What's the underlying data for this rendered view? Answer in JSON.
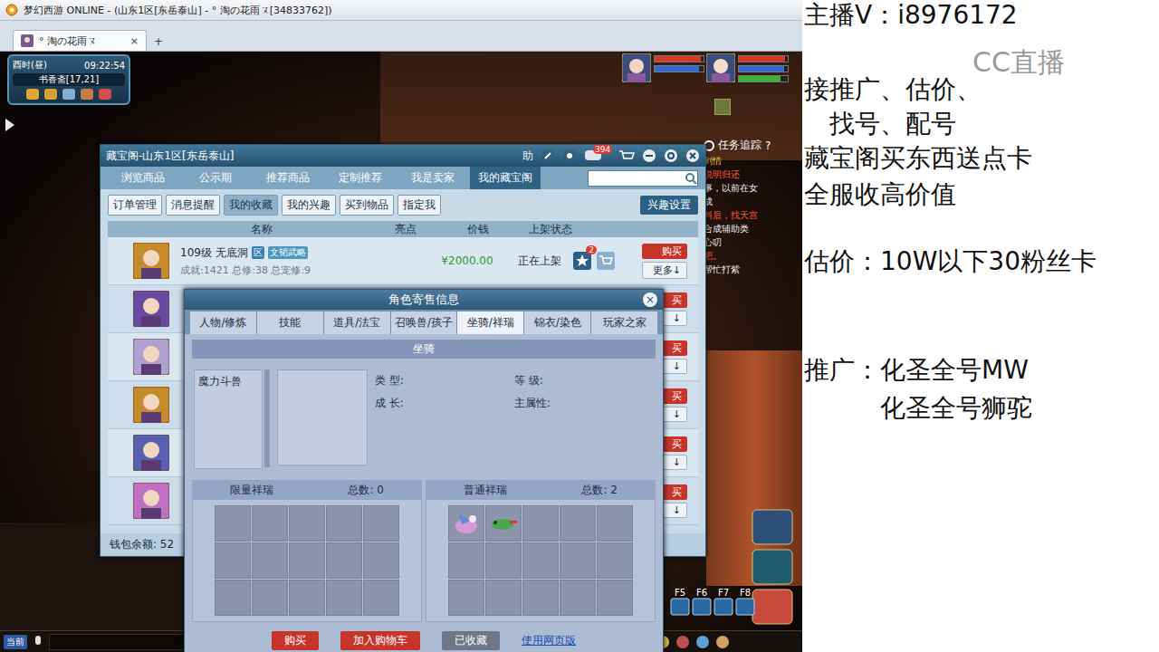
{
  "window": {
    "title": "梦幻西游 ONLINE - (山东1区[东岳泰山] - ° 淘の花雨ㄡ[34833762])",
    "tab": "° 淘の花雨ㄡ",
    "tab_close": "×",
    "new_tab": "+"
  },
  "hud": {
    "time": "酉时(昼)",
    "clock": "09:22:54",
    "location": "书香斋[17,21]",
    "task_title": "任务追踪",
    "task_help": "?",
    "task_lines": [
      "剑情",
      "说明归还",
      "事，以前在女",
      "成",
      "料后，找天宫",
      "合成辅助类",
      "心叨",
      "吧。",
      "帮忙打紫"
    ],
    "hotkeys": [
      "F5",
      "F6",
      "F7",
      "F8"
    ],
    "channel": "当前",
    "pet_bars": [
      {
        "color": "#d63a2a",
        "level": 0.95
      },
      {
        "color": "#2f6bd6",
        "level": 0.9
      }
    ],
    "player_bars": [
      {
        "color": "#d63a2a",
        "level": 0.95
      },
      {
        "color": "#2f6bd6",
        "level": 0.92
      },
      {
        "color": "#38b43a",
        "level": 0.85
      }
    ]
  },
  "cbg": {
    "title": "藏宝阁-山东1区[东岳泰山]",
    "help": "助",
    "message_count": "394",
    "tabs": [
      {
        "label": "浏览商品",
        "selected": false
      },
      {
        "label": "公示期",
        "selected": false
      },
      {
        "label": "推荐商品",
        "selected": false
      },
      {
        "label": "定制推荐",
        "selected": false
      },
      {
        "label": "我是卖家",
        "selected": false
      },
      {
        "label": "我的藏宝阁",
        "selected": true
      }
    ],
    "subtabs": [
      {
        "label": "订单管理",
        "selected": false
      },
      {
        "label": "消息提醒",
        "selected": false
      },
      {
        "label": "我的收藏",
        "selected": true
      },
      {
        "label": "我的兴趣",
        "selected": false
      },
      {
        "label": "买到物品",
        "selected": false
      },
      {
        "label": "指定我",
        "selected": false
      }
    ],
    "interest_button": "兴趣设置",
    "columns": [
      "名称",
      "亮点",
      "价钱",
      "上架状态"
    ],
    "rows": [
      {
        "title": "109级 无底洞",
        "tags": [
          "区",
          "文韬武略"
        ],
        "stats": "成就:1421 总修:38 总宠修:9",
        "price": "¥2000.00",
        "status": "正在上架",
        "fav_count": "2",
        "buy": "购买",
        "more": "更多↓"
      },
      {
        "buy": "买",
        "more": "↓"
      },
      {
        "buy": "买",
        "more": "↓"
      },
      {
        "buy": "买",
        "more": "↓"
      },
      {
        "buy": "买",
        "more": "↓"
      },
      {
        "buy": "买",
        "more": "↓"
      }
    ],
    "wallet": "钱包余额: 52"
  },
  "dialog": {
    "title": "角色寄售信息",
    "close": "×",
    "tabs": [
      {
        "label": "人物/修炼",
        "selected": false
      },
      {
        "label": "技能",
        "selected": false
      },
      {
        "label": "道具/法宝",
        "selected": false
      },
      {
        "label": "召唤兽/孩子",
        "selected": false
      },
      {
        "label": "坐骑/祥瑞",
        "selected": true
      },
      {
        "label": "锦衣/染色",
        "selected": false
      },
      {
        "label": "玩家之家",
        "selected": false
      }
    ],
    "section": "坐骑",
    "mounts": [
      {
        "name": "魔力斗兽",
        "selected": false
      }
    ],
    "fields": [
      {
        "label": "类 型:",
        "value": ""
      },
      {
        "label": "等 级:",
        "value": ""
      },
      {
        "label": "成 长:",
        "value": ""
      },
      {
        "label": "主属性:",
        "value": ""
      }
    ],
    "limited": {
      "title": "限量祥瑞",
      "total": "总数: 0",
      "slots": [
        false,
        false,
        false,
        false,
        false,
        false,
        false,
        false,
        false,
        false,
        false,
        false,
        false,
        false,
        false
      ]
    },
    "normal": {
      "title": "普通祥瑞",
      "total": "总数: 2",
      "slots": [
        true,
        true,
        false,
        false,
        false,
        false,
        false,
        false,
        false,
        false,
        false,
        false,
        false,
        false,
        false
      ]
    },
    "buttons": [
      {
        "label": "购买",
        "kind": "primary"
      },
      {
        "label": "加入购物车",
        "kind": "primary"
      },
      {
        "label": "已收藏",
        "kind": "muted"
      },
      {
        "label": "使用网页版",
        "kind": "link"
      }
    ]
  },
  "stream": {
    "contact": "主播V：i8976172",
    "services": [
      "接推广、估价、",
      "找号、配号"
    ],
    "offers": [
      "藏宝阁买东西送点卡",
      "全服收高价值"
    ],
    "appraisal": "估价：10W以下30粉丝卡",
    "promo_label": "推广：",
    "promos": [
      "化圣全号MW",
      "化圣全号狮驼"
    ],
    "watermark": "CC直播"
  }
}
